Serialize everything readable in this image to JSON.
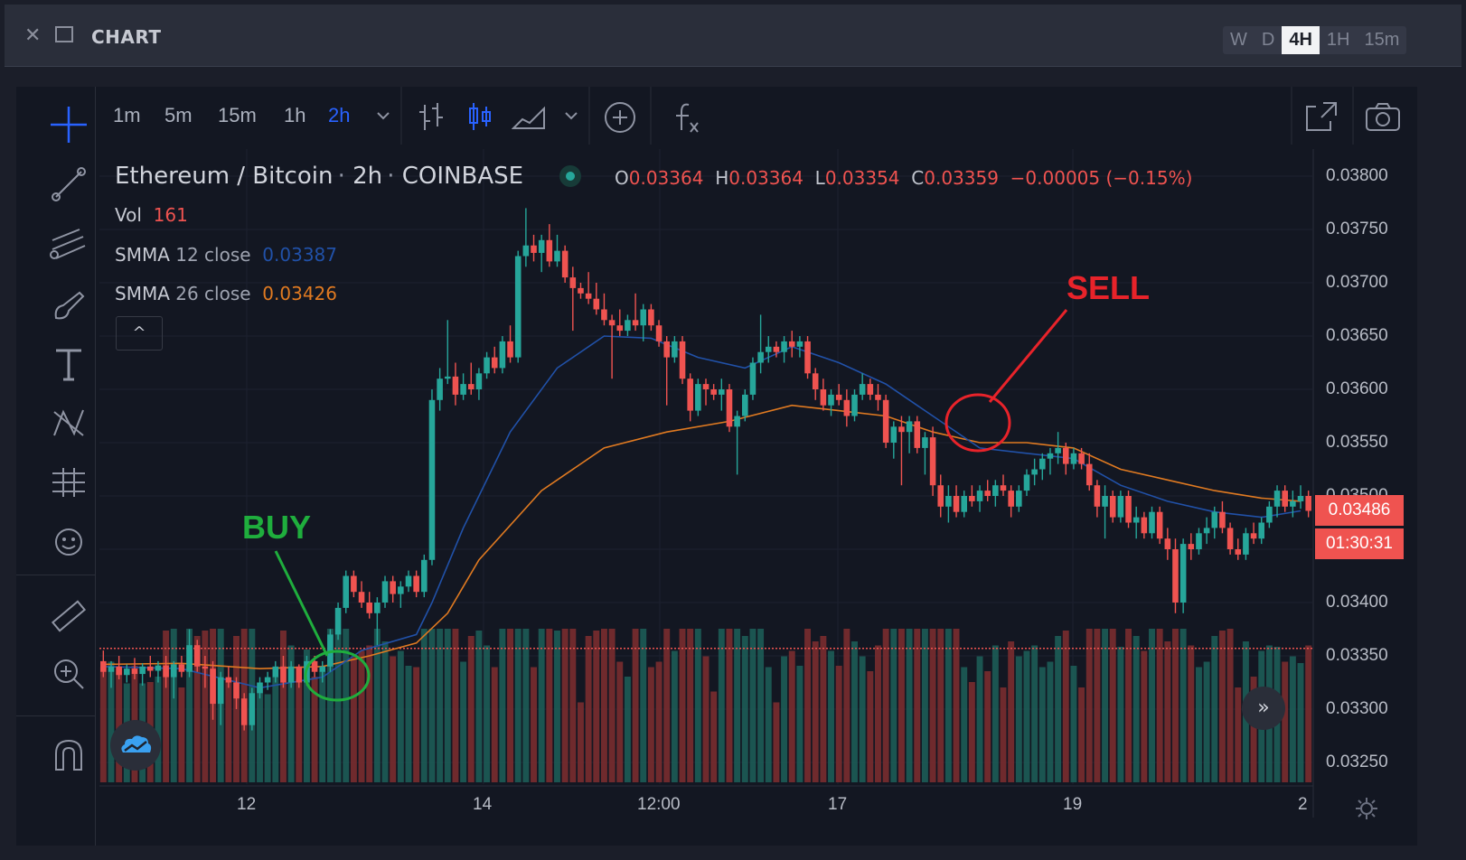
{
  "window": {
    "title": "CHART",
    "timeframes": [
      {
        "label": "W",
        "active": false
      },
      {
        "label": "D",
        "active": false
      },
      {
        "label": "4H",
        "active": true
      },
      {
        "label": "1H",
        "active": false
      },
      {
        "label": "15m",
        "active": false
      }
    ]
  },
  "toolbar": {
    "intervals": [
      {
        "label": "1m",
        "active": false
      },
      {
        "label": "5m",
        "active": false
      },
      {
        "label": "15m",
        "active": false
      },
      {
        "label": "1h",
        "active": false
      },
      {
        "label": "2h",
        "active": true
      }
    ]
  },
  "legend": {
    "symbol": "Ethereum / Bitcoin",
    "interval": "2h",
    "exchange": "COINBASE",
    "open_key": "O",
    "open": "0.03364",
    "high_key": "H",
    "high": "0.03364",
    "low_key": "L",
    "low": "0.03354",
    "close_key": "C",
    "close": "0.03359",
    "change": "−0.00005 (−0.15%)",
    "vol_label": "Vol",
    "vol_value": "161",
    "smma12_label": "SMMA",
    "smma12_params": "12 close",
    "smma12_value": "0.03387",
    "smma26_label": "SMMA",
    "smma26_params": "26 close",
    "smma26_value": "0.03426",
    "collapse_glyph": "^"
  },
  "price_axis": {
    "labels": [
      "0.03800",
      "0.03750",
      "0.03700",
      "0.03650",
      "0.03600",
      "0.03550",
      "0.03500",
      "0.03400",
      "0.03350",
      "0.03300",
      "0.03250"
    ],
    "current_price": "0.03486",
    "countdown": "01:30:31"
  },
  "time_axis": {
    "labels": [
      "12",
      "14",
      "12:00",
      "17",
      "19",
      "2"
    ]
  },
  "annotations": {
    "buy": "BUY",
    "sell": "SELL"
  },
  "colors": {
    "up": "#26a69a",
    "down": "#ef5350",
    "smma12": "#2151a8",
    "smma26": "#e07a21",
    "buy": "#1fae3d",
    "sell": "#e8232a"
  },
  "icons": {
    "crosshair": "crosshair-icon",
    "trendline": "trendline-icon",
    "pitchfork": "pitchfork-icon",
    "brush": "brush-icon",
    "text": "text-icon",
    "pattern": "pattern-icon",
    "measure-tools": "prediction-icon",
    "emoji": "emoji-icon",
    "ruler": "ruler-icon",
    "zoom": "zoom-in-icon",
    "magnet": "magnet-icon"
  },
  "chart_data": {
    "type": "candlestick",
    "title": "",
    "ylim": [
      0.0323,
      0.0381
    ],
    "y_ticks": [
      0.038,
      0.0375,
      0.037,
      0.0365,
      0.036,
      0.0355,
      0.035,
      0.034,
      0.0335,
      0.033,
      0.0325
    ],
    "reference_line": 0.03357,
    "candles": [
      [
        0.03345,
        0.03355,
        0.0333,
        0.03335
      ],
      [
        0.03335,
        0.03345,
        0.0332,
        0.0334
      ],
      [
        0.0334,
        0.0335,
        0.03328,
        0.03332
      ],
      [
        0.03332,
        0.03342,
        0.03325,
        0.03338
      ],
      [
        0.03338,
        0.03348,
        0.03328,
        0.03333
      ],
      [
        0.03333,
        0.03343,
        0.03322,
        0.0334
      ],
      [
        0.0334,
        0.0335,
        0.0333,
        0.03336
      ],
      [
        0.03336,
        0.03345,
        0.03325,
        0.03341
      ],
      [
        0.03341,
        0.0335,
        0.0332,
        0.0333
      ],
      [
        0.0333,
        0.03345,
        0.0331,
        0.03342
      ],
      [
        0.03342,
        0.0335,
        0.0333,
        0.03335
      ],
      [
        0.03335,
        0.03375,
        0.0333,
        0.0336
      ],
      [
        0.0336,
        0.03365,
        0.03335,
        0.0334
      ],
      [
        0.0334,
        0.0335,
        0.0332,
        0.03338
      ],
      [
        0.03338,
        0.03345,
        0.0329,
        0.03305
      ],
      [
        0.03305,
        0.03335,
        0.03285,
        0.0333
      ],
      [
        0.0333,
        0.0334,
        0.0332,
        0.03325
      ],
      [
        0.03325,
        0.0333,
        0.033,
        0.0331
      ],
      [
        0.0331,
        0.03315,
        0.0328,
        0.03285
      ],
      [
        0.03285,
        0.0332,
        0.0328,
        0.03315
      ],
      [
        0.03315,
        0.0333,
        0.0331,
        0.03325
      ],
      [
        0.03325,
        0.03335,
        0.03318,
        0.0333
      ],
      [
        0.0333,
        0.03345,
        0.03325,
        0.0334
      ],
      [
        0.0334,
        0.0335,
        0.0332,
        0.03325
      ],
      [
        0.03325,
        0.03345,
        0.0332,
        0.0334
      ],
      [
        0.0334,
        0.03342,
        0.0332,
        0.03325
      ],
      [
        0.03325,
        0.0335,
        0.03322,
        0.03345
      ],
      [
        0.03345,
        0.0335,
        0.0333,
        0.03335
      ],
      [
        0.03335,
        0.03345,
        0.03325,
        0.0334
      ],
      [
        0.0334,
        0.03375,
        0.03335,
        0.0337
      ],
      [
        0.0337,
        0.034,
        0.03365,
        0.03395
      ],
      [
        0.03395,
        0.0343,
        0.0339,
        0.03425
      ],
      [
        0.03425,
        0.0343,
        0.03405,
        0.0341
      ],
      [
        0.0341,
        0.0342,
        0.03395,
        0.034
      ],
      [
        0.034,
        0.0341,
        0.03385,
        0.0339
      ],
      [
        0.0339,
        0.03405,
        0.0336,
        0.034
      ],
      [
        0.034,
        0.03425,
        0.03395,
        0.0342
      ],
      [
        0.0342,
        0.03425,
        0.034,
        0.03408
      ],
      [
        0.03408,
        0.0342,
        0.03395,
        0.03415
      ],
      [
        0.03415,
        0.0343,
        0.0341,
        0.03425
      ],
      [
        0.03425,
        0.0343,
        0.03405,
        0.0341
      ],
      [
        0.0341,
        0.03445,
        0.03405,
        0.0344
      ],
      [
        0.0344,
        0.036,
        0.03435,
        0.0359
      ],
      [
        0.0359,
        0.0362,
        0.0358,
        0.0361
      ],
      [
        0.0361,
        0.03665,
        0.03605,
        0.03612
      ],
      [
        0.03612,
        0.03625,
        0.03585,
        0.03595
      ],
      [
        0.03595,
        0.03615,
        0.0359,
        0.03605
      ],
      [
        0.03605,
        0.03625,
        0.03595,
        0.036
      ],
      [
        0.036,
        0.0362,
        0.0359,
        0.03615
      ],
      [
        0.03615,
        0.03635,
        0.0361,
        0.0363
      ],
      [
        0.0363,
        0.0364,
        0.03615,
        0.0362
      ],
      [
        0.0362,
        0.0365,
        0.03615,
        0.03645
      ],
      [
        0.03645,
        0.0366,
        0.03625,
        0.0363
      ],
      [
        0.0363,
        0.0373,
        0.03625,
        0.03725
      ],
      [
        0.03725,
        0.0377,
        0.03715,
        0.03735
      ],
      [
        0.03735,
        0.03745,
        0.0372,
        0.03728
      ],
      [
        0.03728,
        0.03745,
        0.0371,
        0.0374
      ],
      [
        0.0374,
        0.03755,
        0.03715,
        0.0372
      ],
      [
        0.0372,
        0.03745,
        0.03715,
        0.0373
      ],
      [
        0.0373,
        0.03735,
        0.037,
        0.03705
      ],
      [
        0.03705,
        0.03715,
        0.03655,
        0.03695
      ],
      [
        0.03695,
        0.037,
        0.03685,
        0.0369
      ],
      [
        0.0369,
        0.0371,
        0.0368,
        0.03685
      ],
      [
        0.03685,
        0.037,
        0.0367,
        0.03675
      ],
      [
        0.03675,
        0.0369,
        0.0366,
        0.03665
      ],
      [
        0.03665,
        0.0367,
        0.0361,
        0.0366
      ],
      [
        0.0366,
        0.03675,
        0.0365,
        0.03655
      ],
      [
        0.03655,
        0.0367,
        0.0365,
        0.03665
      ],
      [
        0.03665,
        0.0369,
        0.03655,
        0.0366
      ],
      [
        0.0366,
        0.0368,
        0.03645,
        0.03675
      ],
      [
        0.03675,
        0.0368,
        0.03655,
        0.0366
      ],
      [
        0.0366,
        0.03665,
        0.0364,
        0.03645
      ],
      [
        0.03645,
        0.0365,
        0.03585,
        0.0363
      ],
      [
        0.0363,
        0.0365,
        0.03625,
        0.03645
      ],
      [
        0.03645,
        0.0365,
        0.03605,
        0.0361
      ],
      [
        0.0361,
        0.03615,
        0.0357,
        0.0358
      ],
      [
        0.0358,
        0.0361,
        0.03575,
        0.03605
      ],
      [
        0.03605,
        0.0361,
        0.03585,
        0.036
      ],
      [
        0.036,
        0.03605,
        0.0359,
        0.03595
      ],
      [
        0.03595,
        0.0361,
        0.0358,
        0.036
      ],
      [
        0.036,
        0.03605,
        0.0356,
        0.03565
      ],
      [
        0.03565,
        0.0358,
        0.0352,
        0.03575
      ],
      [
        0.03575,
        0.036,
        0.0357,
        0.03595
      ],
      [
        0.03595,
        0.0363,
        0.0359,
        0.03625
      ],
      [
        0.03625,
        0.0367,
        0.03615,
        0.03635
      ],
      [
        0.03635,
        0.0365,
        0.03625,
        0.0364
      ],
      [
        0.0364,
        0.03645,
        0.0363,
        0.03635
      ],
      [
        0.03635,
        0.0365,
        0.03625,
        0.03645
      ],
      [
        0.03645,
        0.03655,
        0.0363,
        0.0364
      ],
      [
        0.0364,
        0.0365,
        0.0363,
        0.03645
      ],
      [
        0.03645,
        0.0365,
        0.0361,
        0.03615
      ],
      [
        0.03615,
        0.0362,
        0.0359,
        0.036
      ],
      [
        0.036,
        0.0361,
        0.0358,
        0.03585
      ],
      [
        0.03585,
        0.036,
        0.03575,
        0.03595
      ],
      [
        0.03595,
        0.03605,
        0.03585,
        0.0359
      ],
      [
        0.0359,
        0.036,
        0.03565,
        0.03575
      ],
      [
        0.03575,
        0.036,
        0.0357,
        0.03595
      ],
      [
        0.03595,
        0.03615,
        0.0359,
        0.03605
      ],
      [
        0.03605,
        0.0361,
        0.0359,
        0.03595
      ],
      [
        0.03595,
        0.03605,
        0.0358,
        0.0359
      ],
      [
        0.0359,
        0.03595,
        0.03545,
        0.0355
      ],
      [
        0.0355,
        0.0357,
        0.03535,
        0.03565
      ],
      [
        0.03565,
        0.03575,
        0.0351,
        0.0356
      ],
      [
        0.0356,
        0.03575,
        0.0354,
        0.0357
      ],
      [
        0.0357,
        0.03575,
        0.0354,
        0.03545
      ],
      [
        0.03545,
        0.0356,
        0.0352,
        0.03555
      ],
      [
        0.03555,
        0.03565,
        0.035,
        0.0351
      ],
      [
        0.0351,
        0.0352,
        0.0348,
        0.0349
      ],
      [
        0.0349,
        0.0351,
        0.03475,
        0.035
      ],
      [
        0.035,
        0.0351,
        0.0348,
        0.03485
      ],
      [
        0.03485,
        0.03505,
        0.0348,
        0.035
      ],
      [
        0.035,
        0.0351,
        0.0349,
        0.03495
      ],
      [
        0.03495,
        0.0351,
        0.03485,
        0.03505
      ],
      [
        0.03505,
        0.03515,
        0.03495,
        0.035
      ],
      [
        0.035,
        0.03515,
        0.0349,
        0.0351
      ],
      [
        0.0351,
        0.0352,
        0.035,
        0.03505
      ],
      [
        0.03505,
        0.0351,
        0.0348,
        0.0349
      ],
      [
        0.0349,
        0.0351,
        0.03485,
        0.03505
      ],
      [
        0.03505,
        0.03525,
        0.035,
        0.0352
      ],
      [
        0.0352,
        0.03535,
        0.0351,
        0.03525
      ],
      [
        0.03525,
        0.0354,
        0.03515,
        0.03535
      ],
      [
        0.03535,
        0.03545,
        0.0352,
        0.0354
      ],
      [
        0.0354,
        0.0356,
        0.0353,
        0.03545
      ],
      [
        0.03545,
        0.0355,
        0.0352,
        0.0353
      ],
      [
        0.0353,
        0.03545,
        0.03525,
        0.0354
      ],
      [
        0.0354,
        0.03545,
        0.03525,
        0.0353
      ],
      [
        0.0353,
        0.0354,
        0.03505,
        0.0351
      ],
      [
        0.0351,
        0.03515,
        0.0348,
        0.0349
      ],
      [
        0.0349,
        0.0351,
        0.0346,
        0.035
      ],
      [
        0.035,
        0.03505,
        0.03475,
        0.0348
      ],
      [
        0.0348,
        0.03505,
        0.03475,
        0.035
      ],
      [
        0.035,
        0.03505,
        0.0347,
        0.03475
      ],
      [
        0.03475,
        0.0349,
        0.0346,
        0.0348
      ],
      [
        0.0348,
        0.03485,
        0.0346,
        0.03465
      ],
      [
        0.03465,
        0.0349,
        0.0346,
        0.03485
      ],
      [
        0.03485,
        0.0349,
        0.03455,
        0.0346
      ],
      [
        0.0346,
        0.0347,
        0.0344,
        0.0345
      ],
      [
        0.0345,
        0.0346,
        0.0339,
        0.034
      ],
      [
        0.034,
        0.0346,
        0.0339,
        0.03455
      ],
      [
        0.03455,
        0.03465,
        0.0344,
        0.0345
      ],
      [
        0.0345,
        0.0347,
        0.03445,
        0.03465
      ],
      [
        0.03465,
        0.0348,
        0.03455,
        0.0347
      ],
      [
        0.0347,
        0.0349,
        0.0346,
        0.03485
      ],
      [
        0.03485,
        0.03495,
        0.03465,
        0.0347
      ],
      [
        0.0347,
        0.03475,
        0.03445,
        0.0345
      ],
      [
        0.0345,
        0.0346,
        0.0344,
        0.03445
      ],
      [
        0.03445,
        0.0347,
        0.0344,
        0.03465
      ],
      [
        0.03465,
        0.03475,
        0.03455,
        0.0346
      ],
      [
        0.0346,
        0.0348,
        0.03455,
        0.03475
      ],
      [
        0.03475,
        0.03495,
        0.0347,
        0.0349
      ],
      [
        0.0349,
        0.0351,
        0.0348,
        0.03505
      ],
      [
        0.03505,
        0.0351,
        0.03485,
        0.0349
      ],
      [
        0.0349,
        0.03505,
        0.0348,
        0.03495
      ],
      [
        0.03495,
        0.0351,
        0.03488,
        0.035
      ],
      [
        0.035,
        0.03505,
        0.0348,
        0.03486
      ]
    ],
    "smma12": [
      [
        0,
        0.0334
      ],
      [
        10,
        0.03338
      ],
      [
        20,
        0.0332
      ],
      [
        28,
        0.0333
      ],
      [
        33,
        0.03355
      ],
      [
        40,
        0.0337
      ],
      [
        42,
        0.034
      ],
      [
        46,
        0.0347
      ],
      [
        52,
        0.0356
      ],
      [
        58,
        0.0362
      ],
      [
        64,
        0.0365
      ],
      [
        70,
        0.03648
      ],
      [
        76,
        0.0363
      ],
      [
        82,
        0.0362
      ],
      [
        88,
        0.0364
      ],
      [
        94,
        0.03625
      ],
      [
        100,
        0.03605
      ],
      [
        106,
        0.03575
      ],
      [
        112,
        0.03545
      ],
      [
        118,
        0.0354
      ],
      [
        124,
        0.03535
      ],
      [
        130,
        0.0351
      ],
      [
        136,
        0.03495
      ],
      [
        142,
        0.03485
      ],
      [
        148,
        0.0348
      ],
      [
        153,
        0.03486
      ]
    ],
    "smma26": [
      [
        0,
        0.03342
      ],
      [
        10,
        0.03343
      ],
      [
        20,
        0.03338
      ],
      [
        28,
        0.0334
      ],
      [
        34,
        0.0335
      ],
      [
        40,
        0.03362
      ],
      [
        44,
        0.0339
      ],
      [
        48,
        0.0344
      ],
      [
        56,
        0.03505
      ],
      [
        64,
        0.03545
      ],
      [
        72,
        0.0356
      ],
      [
        80,
        0.0357
      ],
      [
        88,
        0.03585
      ],
      [
        94,
        0.0358
      ],
      [
        100,
        0.03575
      ],
      [
        106,
        0.0356
      ],
      [
        112,
        0.0355
      ],
      [
        118,
        0.0355
      ],
      [
        124,
        0.03545
      ],
      [
        130,
        0.03525
      ],
      [
        136,
        0.03515
      ],
      [
        142,
        0.03505
      ],
      [
        148,
        0.03498
      ],
      [
        153,
        0.03495
      ]
    ]
  }
}
